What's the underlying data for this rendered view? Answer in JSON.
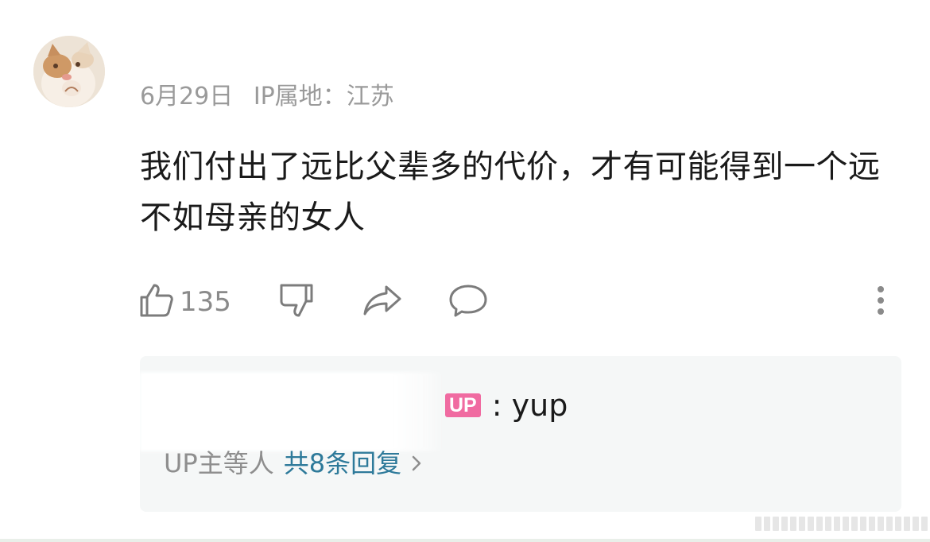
{
  "comment": {
    "date": "6月29日",
    "ip_location": "IP属地：江苏",
    "text": "我们付出了远比父辈多的代价，才有可能得到一个远不如母亲的女人",
    "like_count": "135"
  },
  "icons": {
    "like": "thumbs-up-icon",
    "dislike": "thumbs-down-icon",
    "share": "share-icon",
    "comment": "comment-icon",
    "more": "more-vertical-icon",
    "chevron": "chevron-right-icon"
  },
  "reply": {
    "badge": "UP",
    "text": ": yup",
    "summary_prefix": "UP主等人",
    "summary_link": "共8条回复"
  },
  "colors": {
    "badge": "#f06ba1",
    "link": "#2e7a9a",
    "reply_background": "#f5f7f7"
  }
}
